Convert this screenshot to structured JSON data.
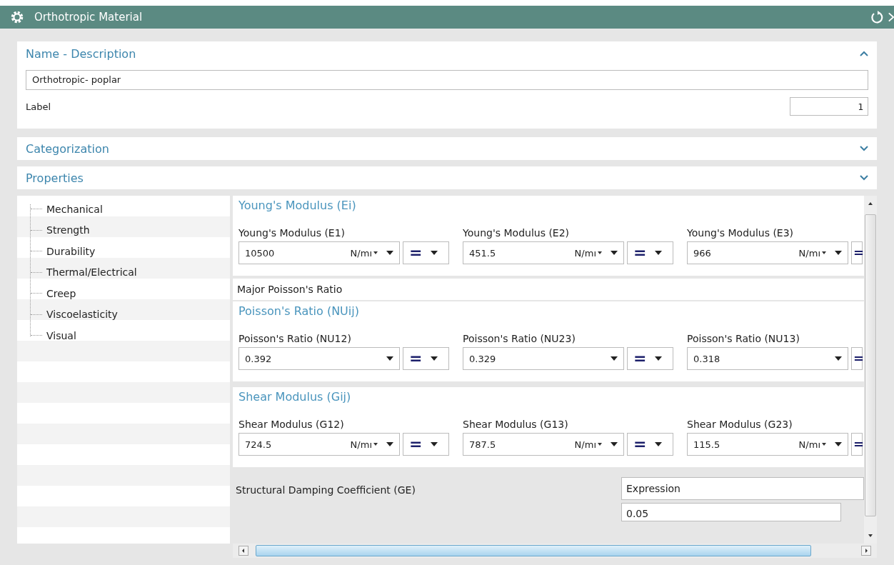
{
  "window": {
    "title": "Orthotropic Material"
  },
  "sections": [
    {
      "title": "Name - Description",
      "expanded": true
    },
    {
      "title": "Categorization",
      "expanded": false
    },
    {
      "title": "Properties",
      "expanded": false
    }
  ],
  "name_field": {
    "value": "Orthotropic- poplar"
  },
  "label_field": {
    "label": "Label",
    "value": "1"
  },
  "tree": {
    "items": [
      {
        "label": "Mechanical"
      },
      {
        "label": "Strength"
      },
      {
        "label": "Durability"
      },
      {
        "label": "Thermal/Electrical"
      },
      {
        "label": "Creep"
      },
      {
        "label": "Viscoelasticity"
      },
      {
        "label": "Visual"
      }
    ]
  },
  "panel": [
    {
      "kind": "group",
      "title": "Young's Modulus (Ei)",
      "fields": [
        {
          "label": "Young's Modulus (E1)",
          "value": "10500",
          "unit": "N/mı",
          "op": "="
        },
        {
          "label": "Young's Modulus (E2)",
          "value": "451.5",
          "unit": "N/mı",
          "op": "="
        },
        {
          "label": "Young's Modulus (E3)",
          "value": "966",
          "unit": "N/mı",
          "op": "="
        }
      ]
    },
    {
      "kind": "row",
      "label": "Major Poisson's Ratio"
    },
    {
      "kind": "group",
      "title": "Poisson's Ratio (NUij)",
      "fields": [
        {
          "label": "Poisson's Ratio (NU12)",
          "value": "0.392",
          "op": "="
        },
        {
          "label": "Poisson's Ratio (NU23)",
          "value": "0.329",
          "op": "="
        },
        {
          "label": "Poisson's Ratio (NU13)",
          "value": "0.318",
          "op": "="
        }
      ]
    },
    {
      "kind": "group",
      "title": "Shear Modulus (Gij)",
      "fields": [
        {
          "label": "Shear Modulus (G12)",
          "value": "724.5",
          "unit": "N/mı",
          "op": "="
        },
        {
          "label": "Shear Modulus (G13)",
          "value": "787.5",
          "unit": "N/mı",
          "op": "="
        },
        {
          "label": "Shear Modulus (G23)",
          "value": "115.5",
          "unit": "N/mı",
          "op": "="
        }
      ]
    },
    {
      "kind": "expression",
      "label": "Structural Damping Coefficient (GE)",
      "method": "Expression",
      "value": "0.05"
    }
  ]
}
